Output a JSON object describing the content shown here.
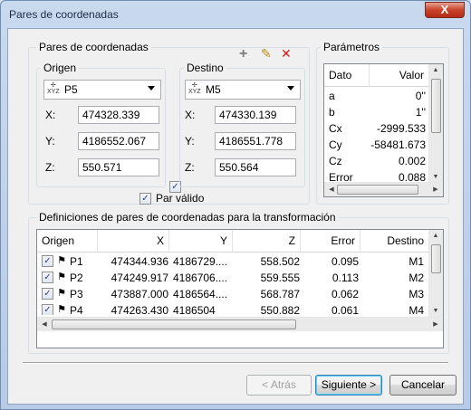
{
  "window": {
    "title": "Pares de coordenadas",
    "close_glyph": "X"
  },
  "pair_group": {
    "title": "Pares de coordenadas",
    "toolbar": {
      "add_glyph": "+",
      "edit_glyph": "✎",
      "delete_glyph": "✕"
    },
    "origin": {
      "title": "Origen",
      "point": "P5",
      "x_label": "X:",
      "x": "474328.339",
      "y_label": "Y:",
      "y": "4186552.067",
      "z_label": "Z:",
      "z": "550.571"
    },
    "target": {
      "title": "Destino",
      "point": "M5",
      "x_label": "X:",
      "x": "474330.139",
      "y_label": "Y:",
      "y": "4186551.778",
      "z_label": "Z:",
      "z": "550.564"
    },
    "z_checkbox_checked": true,
    "valid_label": "Par válido",
    "valid_checked": true
  },
  "params": {
    "title": "Parámetros",
    "columns": [
      "Dato",
      "Valor"
    ],
    "rows": [
      {
        "name": "a",
        "value": "0''"
      },
      {
        "name": "b",
        "value": "1''"
      },
      {
        "name": "Cx",
        "value": "-2999.533"
      },
      {
        "name": "Cy",
        "value": "-58481.673"
      },
      {
        "name": "Cz",
        "value": "0.002"
      },
      {
        "name": "Error",
        "value": "0.088"
      }
    ]
  },
  "defs": {
    "title": "Definiciones de pares de coordenadas para la transformación",
    "columns": [
      "Origen",
      "X",
      "Y",
      "Z",
      "Error",
      "Destino"
    ],
    "rows": [
      {
        "origin": "P1",
        "x": "474344.936",
        "y": "4186729....",
        "z": "558.502",
        "error": "0.095",
        "target": "M1"
      },
      {
        "origin": "P2",
        "x": "474249.917",
        "y": "4186706....",
        "z": "559.555",
        "error": "0.113",
        "target": "M2"
      },
      {
        "origin": "P3",
        "x": "473887.000",
        "y": "4186564....",
        "z": "568.787",
        "error": "0.062",
        "target": "M3"
      },
      {
        "origin": "P4",
        "x": "474263.430",
        "y": "4186504",
        "z": "550.882",
        "error": "0.061",
        "target": "M4"
      }
    ]
  },
  "icons": {
    "point_icon": "xyz-point-icon",
    "row_icon": "survey-point-icon"
  },
  "buttons": {
    "back": "< Atrás",
    "next": "Siguiente >",
    "cancel": "Cancelar"
  }
}
